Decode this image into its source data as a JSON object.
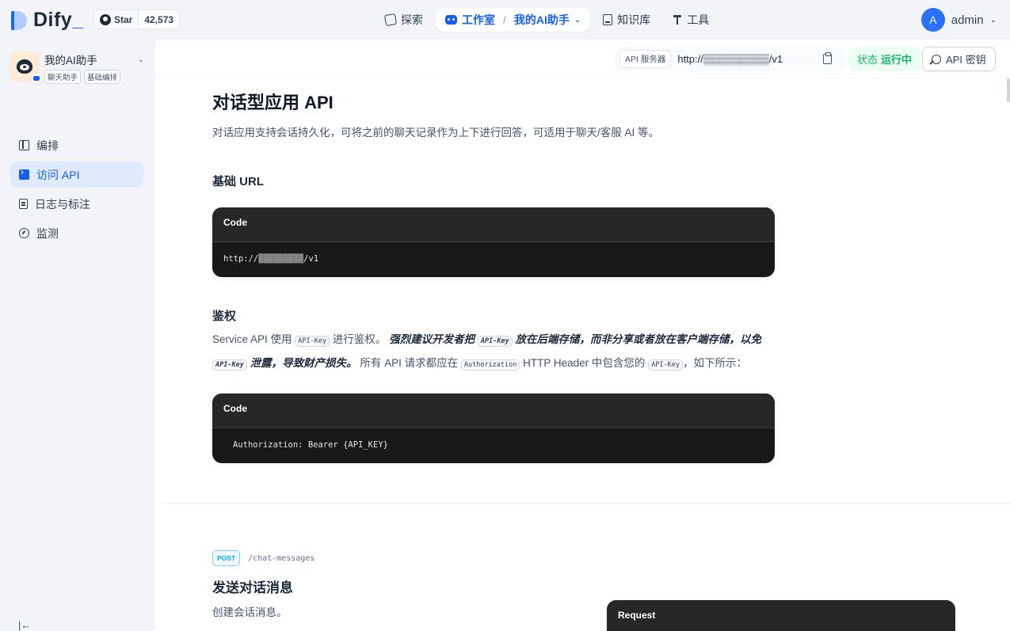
{
  "header": {
    "logo": "Dify",
    "github": {
      "star_label": "Star",
      "count": "42,573"
    },
    "nav": {
      "explore": "探索",
      "studio": "工作室",
      "separator": "/",
      "current_app": "我的AI助手",
      "knowledge": "知识库",
      "tools": "工具"
    },
    "user": {
      "initial": "A",
      "name": "admin"
    }
  },
  "sidebar": {
    "app": {
      "name": "我的AI助手",
      "tags": [
        "聊天助手",
        "基础编排"
      ]
    },
    "items": [
      {
        "label": "编排",
        "icon": "layout-icon"
      },
      {
        "label": "访问 API",
        "icon": "terminal-icon"
      },
      {
        "label": "日志与标注",
        "icon": "log-icon"
      },
      {
        "label": "监测",
        "icon": "monitor-icon"
      }
    ]
  },
  "api_bar": {
    "server_label": "API 服务器",
    "server_url": "http://▒▒▒▒▒▒▒▒▒/v1",
    "status_key": "状态",
    "status_value": "运行中",
    "api_key_button": "API 密钥"
  },
  "doc": {
    "title": "对话型应用 API",
    "description": "对话应用支持会话持久化，可将之前的聊天记录作为上下进行回答，可适用于聊天/客服 AI 等。",
    "base_url_heading": "基础 URL",
    "code_label": "Code",
    "base_url_code": "http://▒▒▒▒▒▒▒▒▒/v1",
    "auth_heading": "鉴权",
    "auth_p1": "Service API 使用 ",
    "auth_key": "API-Key",
    "auth_p2": " 进行鉴权。",
    "auth_em1": "强烈建议开发者把 ",
    "auth_em2": " 放在后端存储，而非分享或者放在客户端存储，以免 ",
    "auth_em3": " 泄露，导致财产损失。",
    "auth_p3": " 所有 API 请求都应在 ",
    "auth_header_code": "Authorization",
    "auth_p4": " HTTP Header 中包含您的 ",
    "auth_p5": "，如下所示：",
    "auth_code": "Authorization: Bearer {API_KEY}",
    "endpoint": {
      "method": "POST",
      "path": "/chat-messages",
      "title": "发送对话消息",
      "description": "创建会话消息。",
      "request_label": "Request"
    }
  }
}
